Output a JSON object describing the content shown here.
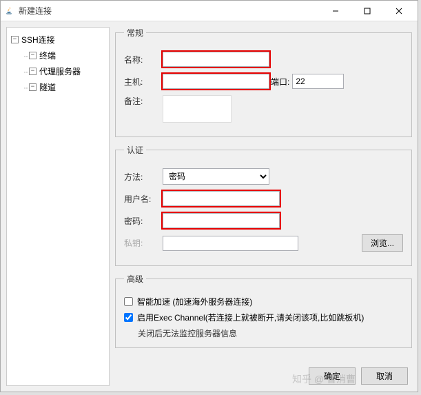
{
  "title": "新建连接",
  "win": {
    "min": "minimize",
    "max": "maximize",
    "close": "close"
  },
  "sidebar": {
    "items": [
      {
        "label": "SSH连接",
        "expanded": true
      },
      {
        "label": "终端",
        "expanded": true
      },
      {
        "label": "代理服务器",
        "expanded": true
      },
      {
        "label": "隧道",
        "expanded": true
      }
    ]
  },
  "general": {
    "legend": "常规",
    "name_label": "名称:",
    "name_value": "",
    "host_label": "主机:",
    "host_value": "",
    "port_label": "端口:",
    "port_value": "22",
    "memo_label": "备注:",
    "memo_value": ""
  },
  "auth": {
    "legend": "认证",
    "method_label": "方法:",
    "method_value": "密码",
    "method_options": [
      "密码"
    ],
    "user_label": "用户名:",
    "user_value": "",
    "pass_label": "密码:",
    "pass_value": "",
    "priv_label": "私钥:",
    "priv_value": "",
    "browse_button": "浏览..."
  },
  "advanced": {
    "legend": "高级",
    "accel_checked": false,
    "accel_label": "智能加速 (加速海外服务器连接)",
    "exec_checked": true,
    "exec_label": "启用Exec Channel(若连接上就被断开,请关闭该项,比如跳板机)",
    "exec_note": "关闭后无法监控服务器信息"
  },
  "buttons": {
    "ok": "确定",
    "cancel": "取消"
  },
  "watermark": "知乎 @ 曹消曹"
}
